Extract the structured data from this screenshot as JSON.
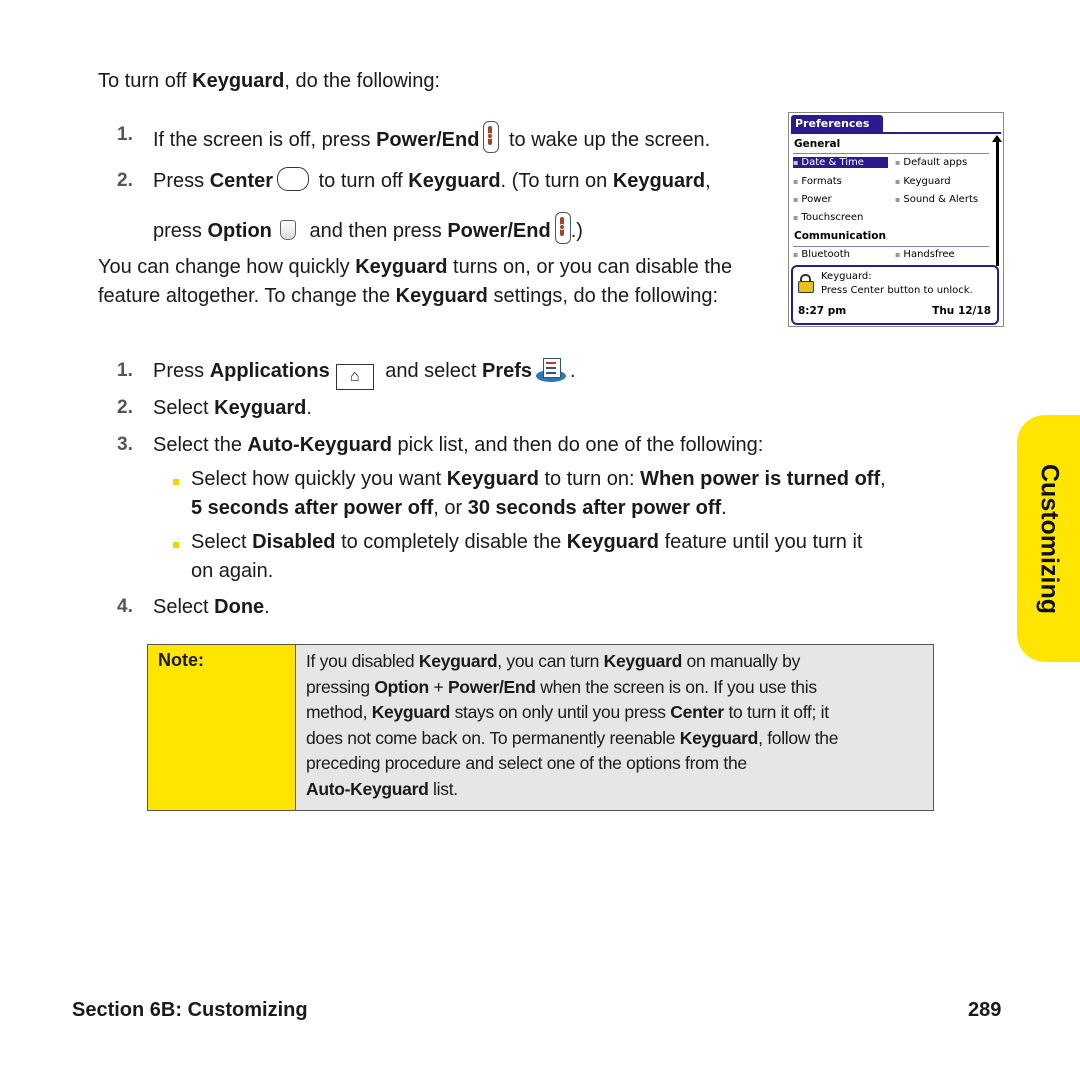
{
  "intro": {
    "pre": "To turn off ",
    "bold": "Keyguard",
    "post": ", do the following:"
  },
  "steps_off": [
    {
      "number": "1.",
      "parts": [
        "If the screen is off, press ",
        "Power/End",
        " to wake up the screen."
      ]
    },
    {
      "number": "2.",
      "parts": [
        "Press ",
        "Center",
        " to turn off ",
        "Keyguard",
        ". (To turn on ",
        "Keyguard",
        ","
      ],
      "line2": [
        "press ",
        "Option",
        " and then press ",
        "Power/End",
        ".)"
      ]
    }
  ],
  "paragraph": {
    "p1": "You can change how quickly ",
    "b1": "Keyguard",
    "p2": " turns on, or you can disable the feature altogether. To change the ",
    "b2": "Keyguard",
    "p3": " settings, do the following:"
  },
  "steps_settings": [
    {
      "number": "1.",
      "pre": "Press ",
      "b1": "Applications",
      "mid": " and select ",
      "b2": "Prefs",
      "post": "."
    },
    {
      "number": "2.",
      "pre": "Select ",
      "b1": "Keyguard",
      "post": "."
    },
    {
      "number": "3.",
      "pre": "Select the ",
      "b1": "Auto-Keyguard",
      "post": " pick list, and then do one of the following:"
    },
    {
      "number": "4.",
      "pre": "Select ",
      "b1": "Done",
      "post": "."
    }
  ],
  "bullets": [
    {
      "line1": [
        "Select how quickly you want ",
        "Keyguard",
        " to turn on: ",
        "When power is turned off",
        ","
      ],
      "line2": [
        "5 seconds after power off",
        ", or ",
        "30 seconds after power off",
        "."
      ]
    },
    {
      "line1": [
        "Select ",
        "Disabled",
        " to completely disable the ",
        "Keyguard",
        " feature until you turn it"
      ],
      "line2": [
        "on again."
      ]
    }
  ],
  "phone_screen": {
    "title": "Preferences",
    "sections": [
      {
        "name": "General",
        "items": [
          "Date & Time",
          "Default apps",
          "Formats",
          "Keyguard",
          "Power",
          "Sound & Alerts",
          "Touchscreen"
        ]
      },
      {
        "name": "Communication",
        "items": [
          "Bluetooth",
          "Handsfree"
        ]
      }
    ],
    "selected_item": "Date & Time",
    "popup": {
      "title": "Keyguard:",
      "message": "Press Center button to unlock."
    },
    "time": "8:27 pm",
    "date": "Thu 12/18"
  },
  "note": {
    "label": "Note:",
    "lines": [
      [
        "If you disabled ",
        "Keyguard",
        ", you can turn ",
        "Keyguard",
        " on manually by"
      ],
      [
        "pressing ",
        "Option",
        " + ",
        "Power/End",
        " when the screen is on. If you use this"
      ],
      [
        "method, ",
        "Keyguard",
        " stays on only until you press ",
        "Center",
        " to turn it off; it"
      ],
      [
        "does not come back on. To permanently reenable ",
        "Keyguard",
        ", follow the"
      ],
      [
        "preceding procedure and select one of the options from the"
      ],
      [
        "",
        "Auto-Keyguard",
        " list."
      ]
    ]
  },
  "side_tab": "Customizing",
  "footer": {
    "section": "Section 6B: Customizing",
    "page": "289"
  },
  "colors": {
    "accent_yellow": "#ffe500",
    "palm_blue": "#2a1b8e"
  }
}
